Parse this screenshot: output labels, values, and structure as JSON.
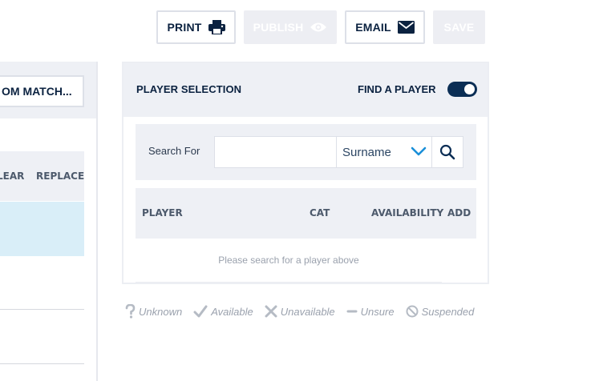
{
  "toolbar": {
    "print_label": "PRINT",
    "publish_label": "PUBLISH",
    "email_label": "EMAIL",
    "save_label": "SAVE"
  },
  "left": {
    "match_button_label": "OM MATCH...",
    "columns": [
      "LEAR",
      "REPLACE"
    ]
  },
  "player_selection": {
    "title": "PLAYER SELECTION",
    "find_label": "FIND A PLAYER",
    "find_toggle_on": true,
    "search": {
      "label": "Search For",
      "value": "",
      "placeholder": "",
      "field_selected": "Surname"
    },
    "columns": {
      "player": "PLAYER",
      "cat": "CAT",
      "availability": "AVAILABILITY",
      "add": "ADD"
    },
    "empty_message": "Please search for a player above"
  },
  "legend": [
    {
      "icon": "question-icon",
      "label": "Unknown"
    },
    {
      "icon": "check-icon",
      "label": "Available"
    },
    {
      "icon": "cross-icon",
      "label": "Unavailable"
    },
    {
      "icon": "dash-icon",
      "label": "Unsure"
    },
    {
      "icon": "prohibited-icon",
      "label": "Suspended"
    }
  ],
  "colors": {
    "navy": "#0b2240",
    "panel_bg": "#eef0f5",
    "selected_row": "#d9eef8",
    "chevron_blue": "#1a8fd8",
    "muted_text": "#9aa1ad"
  }
}
